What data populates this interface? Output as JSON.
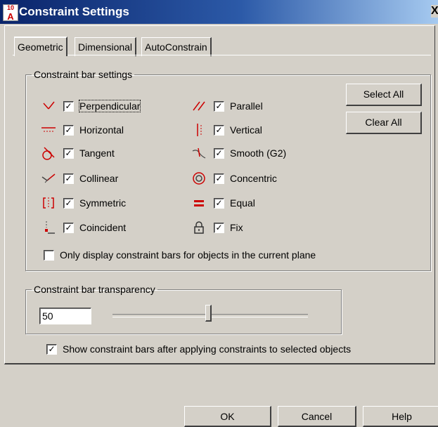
{
  "window": {
    "title": "Constraint Settings",
    "app_icon_text": "A",
    "app_icon_sup": "10",
    "close_label": "X"
  },
  "tabs": [
    {
      "label": "Geometric",
      "active": true
    },
    {
      "label": "Dimensional",
      "active": false
    },
    {
      "label": "AutoConstrain",
      "active": false
    }
  ],
  "constraint_bar_settings": {
    "legend": "Constraint bar settings",
    "left_column": [
      {
        "label": "Perpendicular",
        "checked": true,
        "icon": "perpendicular-icon"
      },
      {
        "label": "Horizontal",
        "checked": true,
        "icon": "horizontal-icon"
      },
      {
        "label": "Tangent",
        "checked": true,
        "icon": "tangent-icon"
      },
      {
        "label": "Collinear",
        "checked": true,
        "icon": "collinear-icon"
      },
      {
        "label": "Symmetric",
        "checked": true,
        "icon": "symmetric-icon"
      },
      {
        "label": "Coincident",
        "checked": true,
        "icon": "coincident-icon"
      }
    ],
    "right_column": [
      {
        "label": "Parallel",
        "checked": true,
        "icon": "parallel-icon"
      },
      {
        "label": "Vertical",
        "checked": true,
        "icon": "vertical-icon"
      },
      {
        "label": "Smooth (G2)",
        "checked": true,
        "icon": "smooth-icon"
      },
      {
        "label": "Concentric",
        "checked": true,
        "icon": "concentric-icon"
      },
      {
        "label": "Equal",
        "checked": true,
        "icon": "equal-icon"
      },
      {
        "label": "Fix",
        "checked": true,
        "icon": "lock-icon"
      }
    ],
    "select_all_label": "Select All",
    "clear_all_label": "Clear All",
    "only_current_plane_label": "Only display constraint bars for objects in the current plane",
    "only_current_plane_checked": false
  },
  "transparency": {
    "legend": "Constraint bar transparency",
    "value": "50",
    "slider_fraction": 0.5
  },
  "show_after_apply": {
    "label": "Show constraint bars after applying constraints to selected objects",
    "checked": true
  },
  "buttons": {
    "ok": "OK",
    "cancel": "Cancel",
    "help": "Help"
  },
  "colors": {
    "title_gradient_start": "#0a246a",
    "title_gradient_end": "#a6caf0",
    "icon_red": "#cc0000",
    "dialog_bg": "#d4d0c8"
  },
  "check_glyph": "✓"
}
